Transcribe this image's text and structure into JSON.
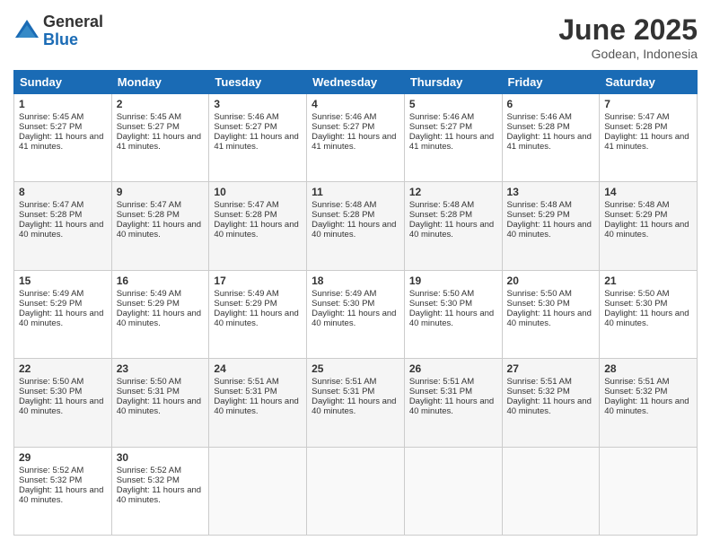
{
  "header": {
    "logo_general": "General",
    "logo_blue": "Blue",
    "month_title": "June 2025",
    "location": "Godean, Indonesia"
  },
  "weekdays": [
    "Sunday",
    "Monday",
    "Tuesday",
    "Wednesday",
    "Thursday",
    "Friday",
    "Saturday"
  ],
  "weeks": [
    [
      {
        "day": "1",
        "sunrise": "5:45 AM",
        "sunset": "5:27 PM",
        "daylight": "11 hours and 41 minutes."
      },
      {
        "day": "2",
        "sunrise": "5:45 AM",
        "sunset": "5:27 PM",
        "daylight": "11 hours and 41 minutes."
      },
      {
        "day": "3",
        "sunrise": "5:46 AM",
        "sunset": "5:27 PM",
        "daylight": "11 hours and 41 minutes."
      },
      {
        "day": "4",
        "sunrise": "5:46 AM",
        "sunset": "5:27 PM",
        "daylight": "11 hours and 41 minutes."
      },
      {
        "day": "5",
        "sunrise": "5:46 AM",
        "sunset": "5:27 PM",
        "daylight": "11 hours and 41 minutes."
      },
      {
        "day": "6",
        "sunrise": "5:46 AM",
        "sunset": "5:28 PM",
        "daylight": "11 hours and 41 minutes."
      },
      {
        "day": "7",
        "sunrise": "5:47 AM",
        "sunset": "5:28 PM",
        "daylight": "11 hours and 41 minutes."
      }
    ],
    [
      {
        "day": "8",
        "sunrise": "5:47 AM",
        "sunset": "5:28 PM",
        "daylight": "11 hours and 40 minutes."
      },
      {
        "day": "9",
        "sunrise": "5:47 AM",
        "sunset": "5:28 PM",
        "daylight": "11 hours and 40 minutes."
      },
      {
        "day": "10",
        "sunrise": "5:47 AM",
        "sunset": "5:28 PM",
        "daylight": "11 hours and 40 minutes."
      },
      {
        "day": "11",
        "sunrise": "5:48 AM",
        "sunset": "5:28 PM",
        "daylight": "11 hours and 40 minutes."
      },
      {
        "day": "12",
        "sunrise": "5:48 AM",
        "sunset": "5:28 PM",
        "daylight": "11 hours and 40 minutes."
      },
      {
        "day": "13",
        "sunrise": "5:48 AM",
        "sunset": "5:29 PM",
        "daylight": "11 hours and 40 minutes."
      },
      {
        "day": "14",
        "sunrise": "5:48 AM",
        "sunset": "5:29 PM",
        "daylight": "11 hours and 40 minutes."
      }
    ],
    [
      {
        "day": "15",
        "sunrise": "5:49 AM",
        "sunset": "5:29 PM",
        "daylight": "11 hours and 40 minutes."
      },
      {
        "day": "16",
        "sunrise": "5:49 AM",
        "sunset": "5:29 PM",
        "daylight": "11 hours and 40 minutes."
      },
      {
        "day": "17",
        "sunrise": "5:49 AM",
        "sunset": "5:29 PM",
        "daylight": "11 hours and 40 minutes."
      },
      {
        "day": "18",
        "sunrise": "5:49 AM",
        "sunset": "5:30 PM",
        "daylight": "11 hours and 40 minutes."
      },
      {
        "day": "19",
        "sunrise": "5:50 AM",
        "sunset": "5:30 PM",
        "daylight": "11 hours and 40 minutes."
      },
      {
        "day": "20",
        "sunrise": "5:50 AM",
        "sunset": "5:30 PM",
        "daylight": "11 hours and 40 minutes."
      },
      {
        "day": "21",
        "sunrise": "5:50 AM",
        "sunset": "5:30 PM",
        "daylight": "11 hours and 40 minutes."
      }
    ],
    [
      {
        "day": "22",
        "sunrise": "5:50 AM",
        "sunset": "5:30 PM",
        "daylight": "11 hours and 40 minutes."
      },
      {
        "day": "23",
        "sunrise": "5:50 AM",
        "sunset": "5:31 PM",
        "daylight": "11 hours and 40 minutes."
      },
      {
        "day": "24",
        "sunrise": "5:51 AM",
        "sunset": "5:31 PM",
        "daylight": "11 hours and 40 minutes."
      },
      {
        "day": "25",
        "sunrise": "5:51 AM",
        "sunset": "5:31 PM",
        "daylight": "11 hours and 40 minutes."
      },
      {
        "day": "26",
        "sunrise": "5:51 AM",
        "sunset": "5:31 PM",
        "daylight": "11 hours and 40 minutes."
      },
      {
        "day": "27",
        "sunrise": "5:51 AM",
        "sunset": "5:32 PM",
        "daylight": "11 hours and 40 minutes."
      },
      {
        "day": "28",
        "sunrise": "5:51 AM",
        "sunset": "5:32 PM",
        "daylight": "11 hours and 40 minutes."
      }
    ],
    [
      {
        "day": "29",
        "sunrise": "5:52 AM",
        "sunset": "5:32 PM",
        "daylight": "11 hours and 40 minutes."
      },
      {
        "day": "30",
        "sunrise": "5:52 AM",
        "sunset": "5:32 PM",
        "daylight": "11 hours and 40 minutes."
      },
      null,
      null,
      null,
      null,
      null
    ]
  ],
  "labels": {
    "sunrise": "Sunrise:",
    "sunset": "Sunset:",
    "daylight": "Daylight:"
  }
}
